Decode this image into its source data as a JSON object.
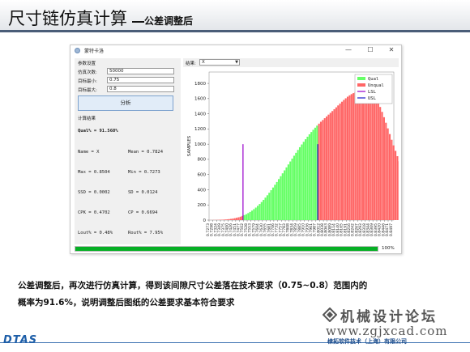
{
  "header": {
    "title_main": "尺寸链仿真计算",
    "title_sub": "公差调整后"
  },
  "window": {
    "app_title": "蒙特卡洛",
    "minimize": "—",
    "maximize": "☐",
    "close": "✕"
  },
  "params": {
    "section_title": "参数设置",
    "sim_count_label": "仿真次数:",
    "sim_count_value": "50000",
    "target_min_label": "目标最小:",
    "target_min_value": "0.75",
    "target_max_label": "目标最大:",
    "target_max_value": "0.8",
    "analyze_button": "分析"
  },
  "results": {
    "section_title": "计算结果",
    "qual": "Qual% = 91.568%",
    "name": "Name  = X",
    "mean": "Mean  = 0.7824",
    "max": "Max   = 0.8504",
    "min": "Min   = 0.7273",
    "ssd": "SSD   = 0.0002",
    "sd": "SD    = 0.0124",
    "cpk": "CPK   = 0.4702",
    "cp": "CP    = 0.6694",
    "lout": "Lout% = 0.48%",
    "rout": "Rout% = 7.95%"
  },
  "result_selector": {
    "label": "结果:",
    "value": "X"
  },
  "chart_data": {
    "type": "bar",
    "ylabel": "SAMPLES",
    "ylim": [
      0,
      1950
    ],
    "yticks": [
      "0",
      "200",
      "400",
      "600",
      "800",
      "1000",
      "1200",
      "1400",
      "1600",
      "1800"
    ],
    "xticks": [
      "0.7273",
      "0.7298",
      "0.7324",
      "0.7349",
      "0.7375",
      "0.7400",
      "0.7426",
      "0.7451",
      "0.7477",
      "0.7502",
      "0.7528",
      "0.7553",
      "0.7579",
      "0.7604",
      "0.7630",
      "0.7655",
      "0.7681",
      "0.7706",
      "0.7732",
      "0.7757",
      "0.7783",
      "0.7808",
      "0.7834",
      "0.7859",
      "0.7885",
      "0.7910",
      "0.7936",
      "0.7961",
      "0.7987",
      "0.8012",
      "0.8038",
      "0.8063",
      "0.8089",
      "0.8114",
      "0.8140",
      "0.8165",
      "0.8191",
      "0.8216",
      "0.8242",
      "0.8267",
      "0.8293",
      "0.8318",
      "0.8344",
      "0.8369",
      "0.8395",
      "0.8420",
      "0.8446",
      "0.8471",
      "0.8497"
    ],
    "lsl": 0.75,
    "usl": 0.8,
    "series": [
      {
        "name": "Qual",
        "color": "#66ff66"
      },
      {
        "name": "Unqual",
        "color": "#ff6666"
      },
      {
        "name": "LSL",
        "color": "#9900cc"
      },
      {
        "name": "USL",
        "color": "#1a1acc"
      }
    ],
    "legend_position": "top-right",
    "bins": {
      "start": 0.7273,
      "width": 0.00128,
      "counts": [
        1,
        1,
        2,
        2,
        3,
        4,
        5,
        6,
        8,
        10,
        13,
        16,
        20,
        25,
        31,
        37,
        45,
        55,
        66,
        78,
        92,
        108,
        125,
        144,
        165,
        188,
        212,
        238,
        266,
        296,
        327,
        360,
        394,
        429,
        465,
        502,
        540,
        578,
        616,
        655,
        694,
        733,
        772,
        810,
        848,
        886,
        924,
        960,
        996,
        1031,
        1065,
        1098,
        1130,
        1160,
        1189,
        1217,
        1244,
        1270,
        1295,
        1318,
        1342,
        1365,
        1389,
        1412,
        1436,
        1460,
        1485,
        1510,
        1535,
        1559,
        1582,
        1604,
        1625,
        1643,
        1659,
        1672,
        1682,
        1689,
        1693,
        1660,
        1690,
        1700,
        1715,
        1730,
        1740,
        1710,
        1650,
        1605,
        1550,
        1490,
        1425,
        1355,
        1282,
        1208,
        1133,
        1058,
        984,
        912,
        842,
        775,
        711,
        651,
        594,
        541,
        491,
        444,
        400,
        359,
        321,
        286,
        253,
        223,
        196,
        171,
        149,
        129,
        111,
        95,
        81,
        68,
        57,
        48,
        40,
        33,
        27,
        22,
        18,
        14,
        11,
        9,
        7,
        5,
        4,
        3,
        2,
        2,
        1,
        1,
        1,
        1
      ]
    }
  },
  "progress": {
    "value": 1.0,
    "label": "100%"
  },
  "paragraph": {
    "line1": "公差调整后，再次进行仿真计算，得到该间隙尺寸公差落在技术要求（0.75~0.8）范围内的",
    "line2": "概率为91.6%，说明调整后图纸的公差要求基本符合要求"
  },
  "watermark": {
    "forum_name": "机械设计论坛",
    "forum_url": "www.zgjxcad.com"
  },
  "footer": {
    "brand": "DTAS",
    "company": "棣拓软件技术（上海）有限公司"
  }
}
